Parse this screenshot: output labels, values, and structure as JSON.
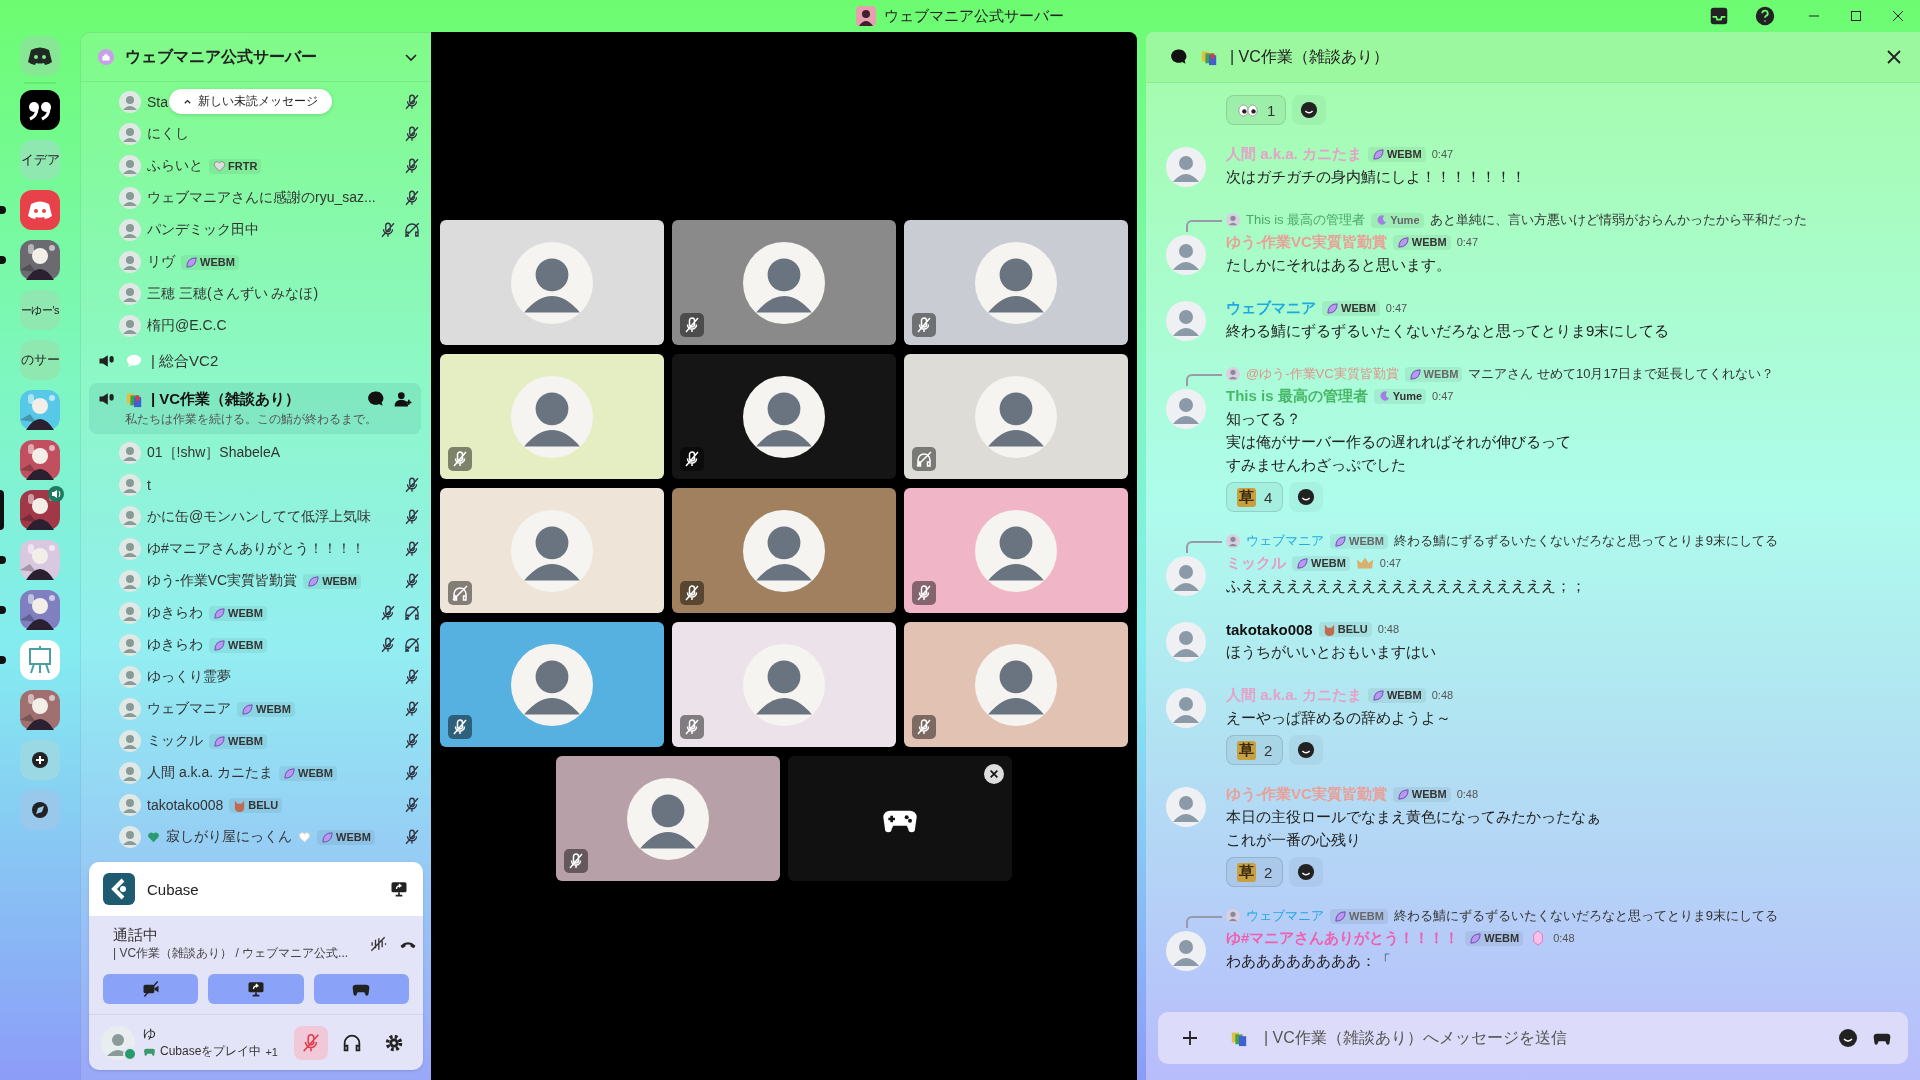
{
  "title_bar": {
    "title": "ウェブマニア公式サーバー"
  },
  "rail": [
    {
      "kind": "logo",
      "selected": false,
      "unread": false,
      "speaking": false
    },
    {
      "kind": "quote",
      "selected": false,
      "unread": false,
      "speaking": false
    },
    {
      "kind": "text",
      "label": "イデア",
      "selected": false,
      "unread": false,
      "speaking": false
    },
    {
      "kind": "logo-red",
      "selected": false,
      "unread": true,
      "speaking": false
    },
    {
      "kind": "picture",
      "color": "#6a6a70",
      "selected": false,
      "unread": true,
      "speaking": false
    },
    {
      "kind": "text",
      "label": "ーゆー's",
      "selected": false,
      "unread": false,
      "speaking": false
    },
    {
      "kind": "text",
      "label": "のサー",
      "selected": false,
      "unread": false,
      "speaking": false
    },
    {
      "kind": "picture",
      "color": "#58c8e8",
      "selected": false,
      "unread": false,
      "speaking": false
    },
    {
      "kind": "picture",
      "color": "#c05060",
      "selected": false,
      "unread": false,
      "speaking": false
    },
    {
      "kind": "picture",
      "color": "#a03848",
      "selected": true,
      "unread": false,
      "speaking": true
    },
    {
      "kind": "picture",
      "color": "#d8c8e0",
      "selected": false,
      "unread": true,
      "speaking": false
    },
    {
      "kind": "picture",
      "color": "#8080c0",
      "selected": false,
      "unread": true,
      "speaking": false
    },
    {
      "kind": "easel",
      "selected": false,
      "unread": true,
      "speaking": false
    },
    {
      "kind": "picture",
      "color": "#a07070",
      "selected": false,
      "unread": false,
      "speaking": false
    },
    {
      "kind": "add",
      "selected": false,
      "unread": false,
      "speaking": false
    },
    {
      "kind": "explore",
      "selected": false,
      "unread": false,
      "speaking": false
    }
  ],
  "server": {
    "name": "ウェブマニア公式サーバー"
  },
  "unread_pill": {
    "label": "新しい未読メッセージ"
  },
  "members_top": [
    {
      "name": "Sta",
      "muted": true,
      "deafened": false
    },
    {
      "name": "にくし",
      "muted": true,
      "deafened": false
    },
    {
      "name": "ふらいと",
      "badge": {
        "kind": "heart",
        "label": "FRTR"
      },
      "muted": true,
      "deafened": false
    },
    {
      "name": "ウェブマニアさんに感謝のryu_saz...",
      "muted": true,
      "deafened": false
    },
    {
      "name": "パンデミック田中",
      "muted": true,
      "deafened": true
    },
    {
      "name": "リヴ",
      "badge": {
        "kind": "leaf",
        "label": "WEBM"
      },
      "muted": false,
      "deafened": false
    },
    {
      "name": "三穂 三穂(さんずい みなほ)",
      "muted": false,
      "deafened": false
    },
    {
      "name": "楕円@E.C.C",
      "muted": false,
      "deafened": false
    }
  ],
  "channels": [
    {
      "name": "| 総合VC2",
      "kind": "bubble",
      "selected": false
    },
    {
      "name": "| VC作業（雑談あり）",
      "kind": "books",
      "selected": true,
      "description": "私たちは作業を続ける。この鯖が終わるまで。"
    }
  ],
  "members": [
    {
      "name": "01［!shw］ShabeleA",
      "muted": false,
      "deafened": false
    },
    {
      "name": "t",
      "muted": true,
      "deafened": false
    },
    {
      "name": "かに缶@モンハンしてて低浮上気味",
      "muted": true,
      "deafened": false
    },
    {
      "name": "ゆ#マニアさんありがとう！！！！",
      "muted": true,
      "deafened": false
    },
    {
      "name": "ゆう-作業VC実質皆勤賞",
      "badge": {
        "kind": "leaf",
        "label": "WEBM"
      },
      "muted": true,
      "deafened": false
    },
    {
      "name": "ゆきらわ",
      "badge": {
        "kind": "leaf",
        "label": "WEBM"
      },
      "muted": true,
      "deafened": true
    },
    {
      "name": "ゆきらわ",
      "badge": {
        "kind": "leaf",
        "label": "WEBM"
      },
      "muted": true,
      "deafened": true
    },
    {
      "name": "ゆっくり霊夢",
      "muted": true,
      "deafened": false
    },
    {
      "name": "ウェブマニア",
      "badge": {
        "kind": "leaf",
        "label": "WEBM"
      },
      "muted": true,
      "deafened": false
    },
    {
      "name": "ミックル",
      "badge": {
        "kind": "leaf",
        "label": "WEBM"
      },
      "muted": true,
      "deafened": false
    },
    {
      "name": "人間 a.k.a. カニたま",
      "badge": {
        "kind": "leaf",
        "label": "WEBM"
      },
      "muted": true,
      "deafened": false
    },
    {
      "name": "takotako008",
      "badge": {
        "kind": "cat",
        "label": "BELU"
      },
      "muted": true,
      "deafened": false
    },
    {
      "name": "寂しがり屋にっくん",
      "hearted": true,
      "badge": {
        "kind": "leaf",
        "label": "WEBM"
      },
      "muted": true,
      "deafened": false
    }
  ],
  "activity": {
    "app": "Cubase"
  },
  "voice": {
    "status": "通話中",
    "location": "| VC作業（雑談あり） / ウェブマニア公式..."
  },
  "user": {
    "name": "ゆ",
    "activity": "Cubaseをプレイ中",
    "extra": "+1",
    "mic_muted": true
  },
  "tiles": [
    {
      "kind": "avatar",
      "color": "#dcdcdc",
      "muted": false,
      "deafened": false
    },
    {
      "kind": "avatar",
      "color": "#8a8a8a",
      "muted": true,
      "deafened": false
    },
    {
      "kind": "avatar",
      "color": "#c9ccd2",
      "muted": true,
      "deafened": false
    },
    {
      "kind": "avatar",
      "color": "#e4eec2",
      "muted": true,
      "deafened": false
    },
    {
      "kind": "avatar",
      "color": "#151515",
      "muted": true,
      "deafened": false
    },
    {
      "kind": "avatar",
      "color": "#dddcd6",
      "muted": false,
      "deafened": true
    },
    {
      "kind": "avatar",
      "color": "#eee4d8",
      "muted": false,
      "deafened": true
    },
    {
      "kind": "avatar",
      "color": "#a0805e",
      "muted": true,
      "deafened": false
    },
    {
      "kind": "avatar",
      "color": "#f0b6c8",
      "muted": true,
      "deafened": false
    },
    {
      "kind": "avatar",
      "color": "#56b0e0",
      "muted": true,
      "deafened": false
    },
    {
      "kind": "avatar",
      "color": "#ece2ea",
      "muted": true,
      "deafened": false
    },
    {
      "kind": "avatar",
      "color": "#e2c2b2",
      "muted": true,
      "deafened": false
    },
    {
      "kind": "avatar",
      "color": "#b8a0a8",
      "muted": true,
      "deafened": false
    },
    {
      "kind": "game",
      "color": "#111111",
      "muted": false,
      "deafened": false
    }
  ],
  "chat": {
    "channel": "| VC作業（雑談あり）",
    "placeholder": "| VC作業（雑談あり）へメッセージを送信",
    "messages": [
      {
        "reactions": [
          {
            "kind": "eyes",
            "count": "1"
          }
        ]
      },
      {
        "author": "人間 a.k.a. カニたま",
        "color": "#e4a2c8",
        "badge": {
          "kind": "leaf",
          "label": "WEBM"
        },
        "time": "0:47",
        "lines": [
          "次はガチガチの身内鯖にしよ！！！！！！！"
        ]
      },
      {
        "reply": {
          "author": "This is 最高の管理者",
          "color": "#4aa868",
          "badge": {
            "kind": "moon",
            "label": "Yume"
          },
          "text": "あと単純に、言い方悪いけど情弱がおらんかったから平和だった"
        },
        "author": "ゆう-作業VC実質皆勤賞",
        "color": "#e8a098",
        "badge": {
          "kind": "leaf",
          "label": "WEBM"
        },
        "time": "0:47",
        "lines": [
          "たしかにそれはあると思います。"
        ]
      },
      {
        "author": "ウェブマニア",
        "color": "#20a8e0",
        "badge": {
          "kind": "leaf",
          "label": "WEBM"
        },
        "time": "0:47",
        "lines": [
          "終わる鯖にずるずるいたくないだろなと思ってとりま9末にしてる"
        ]
      },
      {
        "reply": {
          "author": "@ゆう-作業VC実質皆勤賞",
          "color": "#e0948c",
          "badge": {
            "kind": "leaf",
            "label": "WEBM"
          },
          "text": "マニアさん せめて10月17日まで延長してくれない？"
        },
        "author": "This is 最高の管理者",
        "color": "#48b868",
        "badge": {
          "kind": "moon",
          "label": "Yume"
        },
        "time": "0:47",
        "lines": [
          "知ってる？",
          "実は俺がサーバー作るの遅れればそれが伸びるって",
          "すみませんわざっぷでした"
        ],
        "reactions": [
          {
            "kind": "text",
            "emoji": "草",
            "count": "4"
          }
        ]
      },
      {
        "reply": {
          "author": "ウェブマニア",
          "color": "#20a8e0",
          "badge": {
            "kind": "leaf",
            "label": "WEBM"
          },
          "text": "終わる鯖にずるずるいたくないだろなと思ってとりま9末にしてる"
        },
        "author": "ミックル",
        "color": "#e89ac8",
        "badge": {
          "kind": "leaf",
          "label": "WEBM"
        },
        "flair": {
          "kind": "crown"
        },
        "time": "0:47",
        "lines": [
          "ふえええええええええええええええええええええ；；"
        ]
      },
      {
        "author": "takotako008",
        "color": "#111111",
        "badge": {
          "kind": "cat",
          "label": "BELU"
        },
        "time": "0:48",
        "lines": [
          "ほうちがいいとおもいますはい"
        ]
      },
      {
        "author": "人間 a.k.a. カニたま",
        "color": "#e4a2c8",
        "badge": {
          "kind": "leaf",
          "label": "WEBM"
        },
        "time": "0:48",
        "lines": [
          "えーやっぱ辞めるの辞めようよ～"
        ],
        "reactions": [
          {
            "kind": "text",
            "emoji": "草",
            "count": "2"
          }
        ]
      },
      {
        "author": "ゆう-作業VC実質皆勤賞",
        "color": "#e8a098",
        "badge": {
          "kind": "leaf",
          "label": "WEBM"
        },
        "time": "0:48",
        "lines": [
          "本日の主役ロールでなまえ黄色になってみたかったなぁ",
          "これが一番の心残り"
        ],
        "reactions": [
          {
            "kind": "text",
            "emoji": "草",
            "count": "2"
          }
        ]
      },
      {
        "reply": {
          "author": "ウェブマニア",
          "color": "#20a8e0",
          "badge": {
            "kind": "leaf",
            "label": "WEBM"
          },
          "text": "終わる鯖にずるずるいたくないだろなと思ってとりま9末にしてる"
        },
        "author": "ゆ#マニアさんありがとう！！！！",
        "color": "#f060b0",
        "badge": {
          "kind": "leaf",
          "label": "WEBM"
        },
        "flair": {
          "kind": "gem"
        },
        "time": "0:48",
        "lines": [
          "わああああああああ：「"
        ]
      }
    ]
  }
}
